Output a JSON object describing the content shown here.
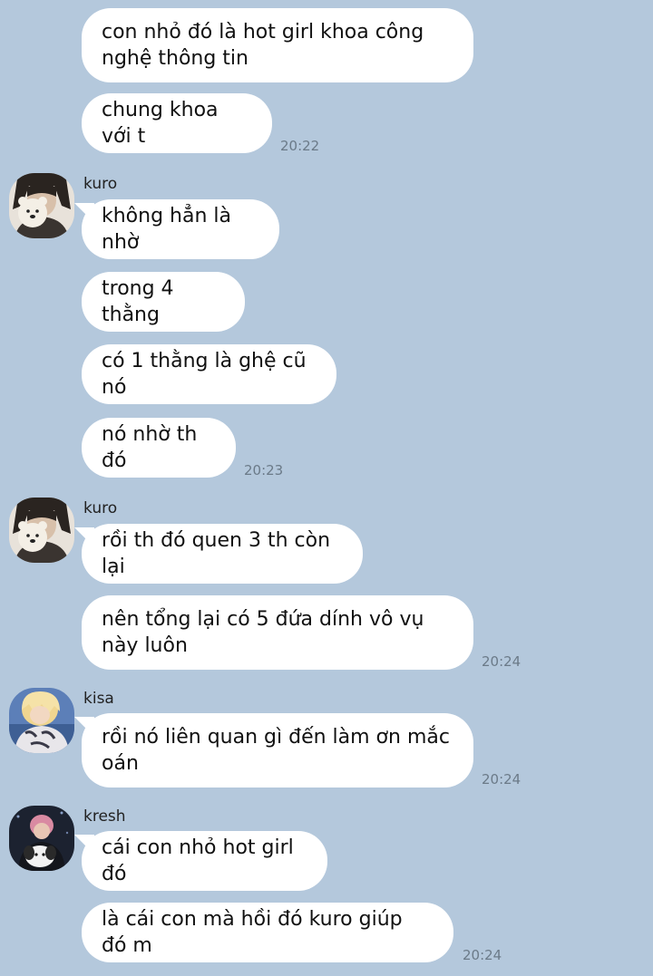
{
  "messages": [
    {
      "text": "con nhỏ đó là hot girl khoa công nghệ thông tin"
    },
    {
      "text": "chung khoa với t",
      "time": "20:22"
    },
    {
      "sender": "kuro",
      "text": "không hẳn là nhờ"
    },
    {
      "text": "trong 4 thằng"
    },
    {
      "text": "có 1 thằng là ghệ cũ nó"
    },
    {
      "text": "nó nhờ th đó",
      "time": "20:23"
    },
    {
      "sender": "kuro",
      "text": "rồi th đó quen 3 th còn lại"
    },
    {
      "text": "nên tổng lại có 5 đứa dính vô vụ này luôn",
      "time": "20:24"
    },
    {
      "sender": "kisa",
      "text": "rồi nó liên quan gì đến làm ơn mắc oán",
      "time": "20:24"
    },
    {
      "sender": "kresh",
      "text": "cái con nhỏ hot girl đó"
    },
    {
      "text": "là cái con mà hồi đó kuro giúp đó m",
      "time": "20:24"
    }
  ],
  "avatars": {
    "kuro": "avatar-person-holding-plush-bear",
    "kisa": "avatar-blond-hair-with-plush",
    "kresh": "avatar-pink-hair-with-dog"
  }
}
